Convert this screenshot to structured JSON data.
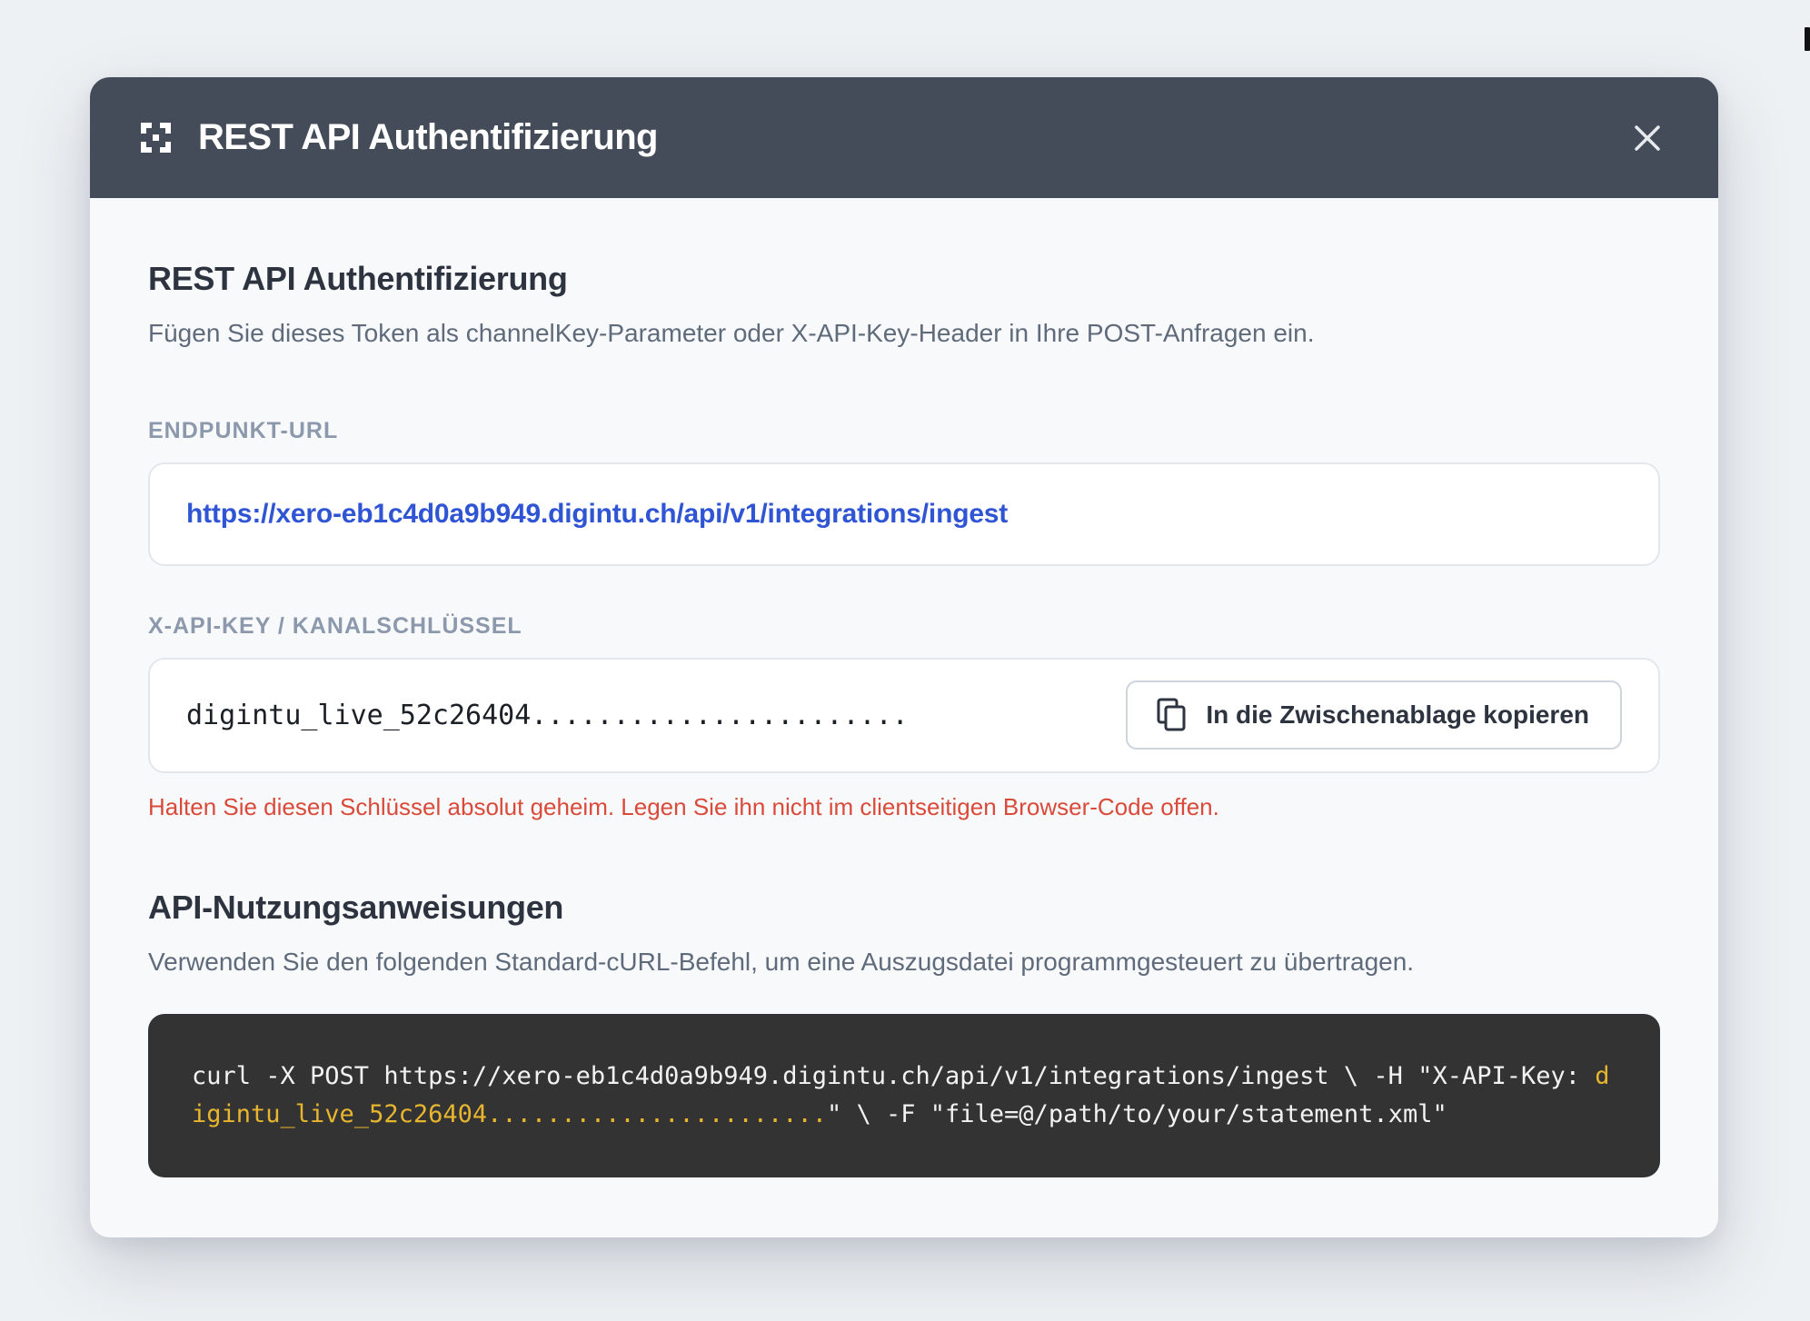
{
  "modal": {
    "title": "REST API Authentifizierung",
    "icons": {
      "logo": "scan-frame-icon",
      "close": "close-icon"
    }
  },
  "auth": {
    "title": "REST API Authentifizierung",
    "description": "Fügen Sie dieses Token als channelKey-Parameter oder X-API-Key-Header in Ihre POST-Anfragen ein."
  },
  "endpoint": {
    "label": "ENDPUNKT-URL",
    "url": "https://xero-eb1c4d0a9b949.digintu.ch/api/v1/integrations/ingest"
  },
  "api_key": {
    "label": "X-API-KEY / KANALSCHLÜSSEL",
    "value": "digintu_live_52c26404.......................",
    "copy_label": "In die Zwischenablage kopieren",
    "copy_icon": "copy-icon",
    "warning": "Halten Sie diesen Schlüssel absolut geheim. Legen Sie ihn nicht im clientseitigen Browser-Code offen."
  },
  "usage": {
    "title": "API-Nutzungsanweisungen",
    "description": "Verwenden Sie den folgenden Standard-cURL-Befehl, um eine Auszugsdatei programmgesteuert zu übertragen.",
    "code_prefix": "curl -X POST https://xero-eb1c4d0a9b949.digintu.ch/api/v1/integrations/ingest \\ -H \"X-API-Key: ",
    "code_key": "digintu_live_52c26404.......................",
    "code_suffix": "\" \\ -F \"file=@/path/to/your/statement.xml\""
  },
  "colors": {
    "header_bg": "#444c59",
    "link": "#2f55d4",
    "warning": "#d94a3a",
    "code_bg": "#333333",
    "code_highlight": "#e8b52e"
  }
}
